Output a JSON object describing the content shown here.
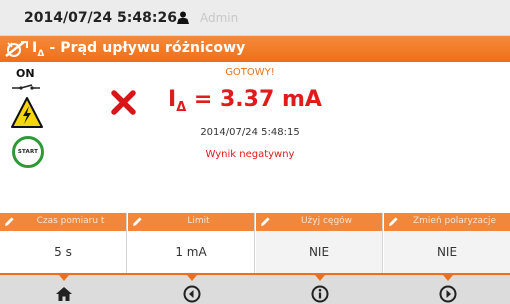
{
  "status_bar": {
    "datetime": "2014/07/24 5:48:26",
    "user_icon": "user-icon",
    "user": "Admin"
  },
  "title_bar": {
    "icon": "rcd-icon",
    "title_prefix": "I",
    "title_symbol": "Δ",
    "title_rest": " - Prąd upływu różnicowy"
  },
  "side_panel": {
    "switch_state": "ON",
    "switch_icon": "switch-icon",
    "warning_icon": "high-voltage-warning-icon",
    "start_label": "START"
  },
  "result": {
    "status": "GOTOWY!",
    "fail_icon": "fail-cross-icon",
    "quantity": "I",
    "quantity_symbol": "Δ",
    "value_text": " = 3.37 mA",
    "timestamp": "2014/07/24 5:48:15",
    "verdict": "Wynik negatywny"
  },
  "params": [
    {
      "label": "Czas pomiaru t",
      "value": "5 s"
    },
    {
      "label": "Limit",
      "value": "1 mA"
    },
    {
      "label": "Użyj cęgów",
      "value": "NIE"
    },
    {
      "label": "Zmień polaryzacje",
      "value": "NIE"
    }
  ],
  "nav": [
    {
      "icon": "home-icon"
    },
    {
      "icon": "back-icon"
    },
    {
      "icon": "info-icon"
    },
    {
      "icon": "forward-icon"
    }
  ],
  "colors": {
    "accent": "#ee6f1b",
    "fail": "#e01b1b",
    "start_ring": "#2e9a37"
  }
}
